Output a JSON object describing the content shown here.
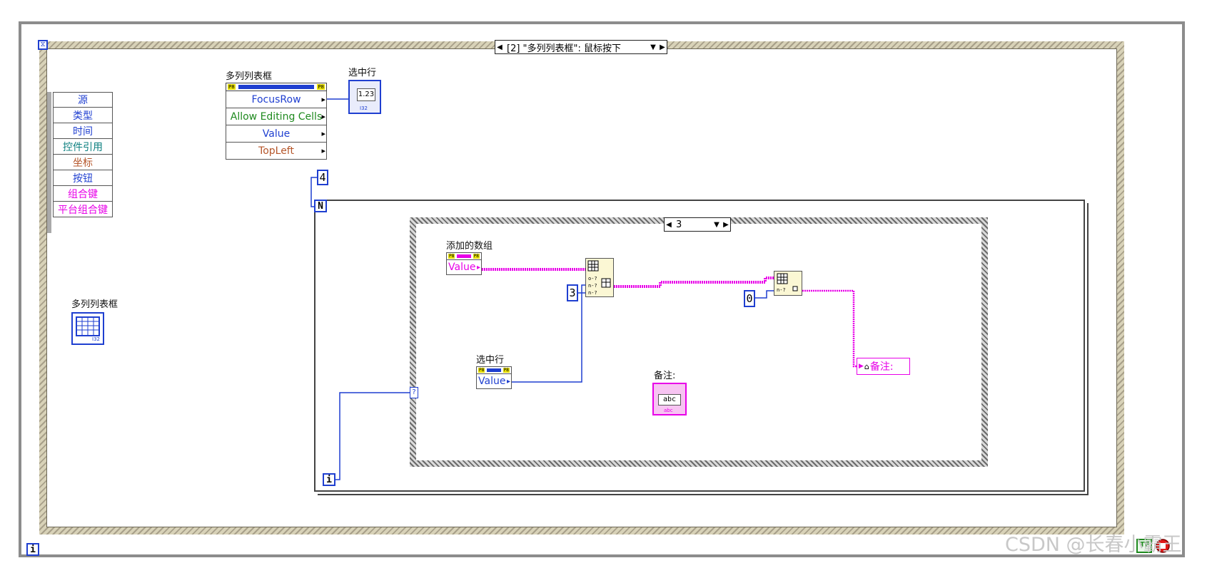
{
  "event_structure": {
    "case_label": "[2] \"多列列表框\": 鼠标按下"
  },
  "event_data_node": {
    "items": [
      {
        "label": "源",
        "color": "#1f3fd0"
      },
      {
        "label": "类型",
        "color": "#1f3fd0"
      },
      {
        "label": "时间",
        "color": "#1f3fd0"
      },
      {
        "label": "控件引用",
        "color": "#0b7f7f"
      },
      {
        "label": "坐标",
        "color": "#b5562a"
      },
      {
        "label": "按钮",
        "color": "#1f3fd0"
      },
      {
        "label": "组合键",
        "color": "#e800e8"
      },
      {
        "label": "平台组合键",
        "color": "#e800e8"
      }
    ]
  },
  "property_node": {
    "title": "多列列表框",
    "properties": [
      {
        "label": "FocusRow",
        "color": "#1f3fd0"
      },
      {
        "label": "Allow Editing Cells",
        "color": "#1f8a1f"
      },
      {
        "label": "Value",
        "color": "#1f3fd0"
      },
      {
        "label": "TopLeft",
        "color": "#b5562a"
      }
    ]
  },
  "selected_row_indicator": {
    "title": "选中行",
    "display": "1.23",
    "type_tag": "I32"
  },
  "listbox_terminal": {
    "title": "多列列表框",
    "type_tag": "I32"
  },
  "for_loop": {
    "count_constant": "4",
    "count_terminal": "N",
    "iteration_terminal": "i",
    "selector_tunnel": "?"
  },
  "case_structure": {
    "selector_value": "3"
  },
  "added_array": {
    "title": "添加的数组",
    "value_label": "Value"
  },
  "selected_row_local": {
    "title": "选中行",
    "value_label": "Value"
  },
  "index_constant_3": "3",
  "index_constant_0": "0",
  "note_indicator": {
    "title": "备注:",
    "display": "abc",
    "type_tag": "abc"
  },
  "note_property": {
    "label": "备注:"
  },
  "outer_loop": {
    "iteration_terminal": "i"
  },
  "watermark": "CSDN @长春小霸王"
}
